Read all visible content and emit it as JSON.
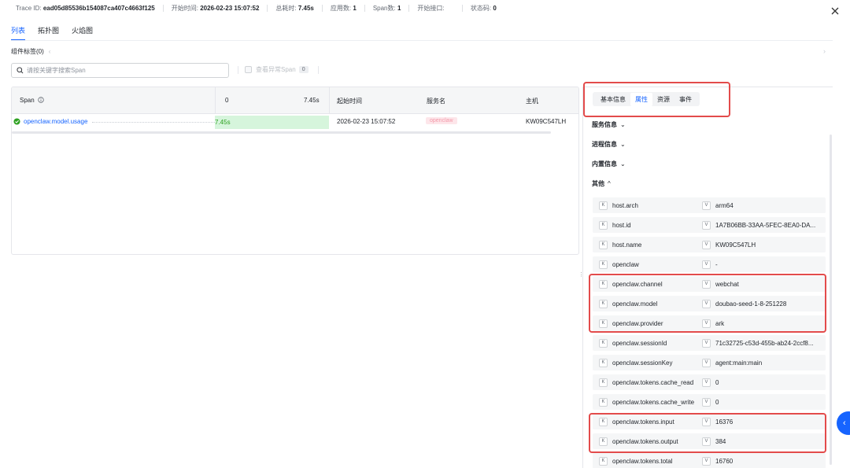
{
  "header": {
    "trace_id_label": "Trace ID:",
    "trace_id": "ead05d85536b154087ca407c4663f125",
    "start_time_label": "开始时间:",
    "start_time": "2026-02-23 15:07:52",
    "duration_label": "总耗时:",
    "duration": "7.45s",
    "app_count_label": "应用数:",
    "app_count": "1",
    "span_count_label": "Span数:",
    "span_count": "1",
    "start_api_label": "开始接口:",
    "start_api": "",
    "status_label": "状态码:",
    "status": "0"
  },
  "view_tabs": [
    {
      "label": "列表",
      "active": true
    },
    {
      "label": "拓扑图",
      "active": false
    },
    {
      "label": "火焰图",
      "active": false
    }
  ],
  "component_label": "组件标签(0)",
  "search": {
    "placeholder": "请按关键字搜索Span",
    "value": ""
  },
  "anomaly": {
    "label": "查看异常Span",
    "count": "0"
  },
  "span_table": {
    "columns": {
      "span": "Span",
      "timeline_start": "0",
      "timeline_end": "7.45s",
      "start_time": "起始时间",
      "service": "服务名",
      "host": "主机"
    },
    "rows": [
      {
        "name": "openclaw.model.usage",
        "duration": "7.45s",
        "start_time": "2026-02-23 15:07:52",
        "service": "openclaw",
        "host": "KW09C547LH"
      }
    ]
  },
  "drawer": {
    "tabs": [
      {
        "label": "基本信息",
        "active": false
      },
      {
        "label": "属性",
        "active": true
      },
      {
        "label": "资源",
        "active": false
      },
      {
        "label": "事件",
        "active": false
      }
    ],
    "sections": [
      {
        "label": "服务信息",
        "chevron": "⌄"
      },
      {
        "label": "进程信息",
        "chevron": "⌄"
      },
      {
        "label": "内置信息",
        "chevron": "⌄"
      },
      {
        "label": "其他",
        "chevron": "^"
      }
    ],
    "k_badge": "K",
    "v_badge": "V",
    "attributes": [
      {
        "key": "host.arch",
        "value": "arm64"
      },
      {
        "key": "host.id",
        "value": "1A7B06BB-33AA-5FEC-8EA0-DA..."
      },
      {
        "key": "host.name",
        "value": "KW09C547LH"
      },
      {
        "key": "openclaw",
        "value": "-"
      },
      {
        "key": "openclaw.channel",
        "value": "webchat"
      },
      {
        "key": "openclaw.model",
        "value": "doubao-seed-1-8-251228"
      },
      {
        "key": "openclaw.provider",
        "value": "ark"
      },
      {
        "key": "openclaw.sessionId",
        "value": "71c32725-c53d-455b-ab24-2ccf8..."
      },
      {
        "key": "openclaw.sessionKey",
        "value": "agent:main:main"
      },
      {
        "key": "openclaw.tokens.cache_read",
        "value": "0"
      },
      {
        "key": "openclaw.tokens.cache_write",
        "value": "0"
      },
      {
        "key": "openclaw.tokens.input",
        "value": "16376"
      },
      {
        "key": "openclaw.tokens.output",
        "value": "384"
      },
      {
        "key": "openclaw.tokens.total",
        "value": "16760"
      }
    ]
  },
  "colors": {
    "accent": "#1664ff",
    "highlight": "#e34b4b",
    "duration_bar": "#d6f5dc"
  }
}
